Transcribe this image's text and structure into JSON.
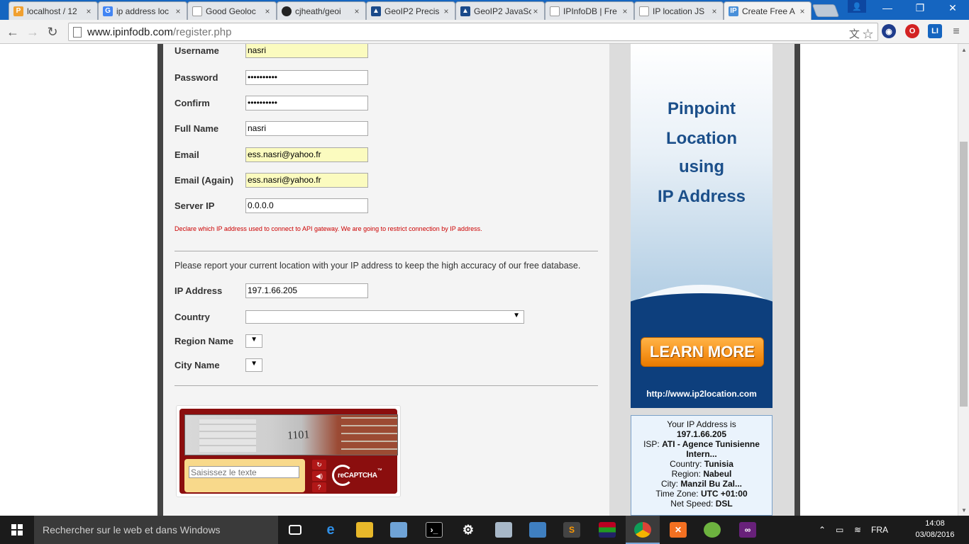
{
  "browser": {
    "tabs": [
      {
        "title": "localhost / 12",
        "favicon": "phpmyadmin-icon",
        "color": "#f0a030"
      },
      {
        "title": "ip address loc",
        "favicon": "google-icon",
        "color": "#4285f4"
      },
      {
        "title": "Good Geoloc",
        "favicon": "page-icon",
        "color": "#b0b0b0"
      },
      {
        "title": "cjheath/geoi",
        "favicon": "github-icon",
        "color": "#222222"
      },
      {
        "title": "GeoIP2 Precis",
        "favicon": "maxmind-icon",
        "color": "#1a4a8a"
      },
      {
        "title": "GeoIP2 JavaSc",
        "favicon": "maxmind-icon",
        "color": "#1a4a8a"
      },
      {
        "title": "IPInfoDB | Fre",
        "favicon": "page-icon",
        "color": "#b0b0b0"
      },
      {
        "title": "IP location JS",
        "favicon": "page-icon",
        "color": "#b0b0b0"
      },
      {
        "title": "Create Free A",
        "favicon": "ipinfodb-icon",
        "color": "#4a90d9"
      }
    ],
    "url_host": "www.ipinfodb.com",
    "url_path": "/register.php"
  },
  "form": {
    "fields": [
      {
        "label": "Username",
        "value": "nasri"
      },
      {
        "label": "Password",
        "value": "••••••••••"
      },
      {
        "label": "Confirm",
        "value": "••••••••••"
      },
      {
        "label": "Full Name",
        "value": "nasri"
      },
      {
        "label": "Email",
        "value": "ess.nasri@yahoo.fr"
      },
      {
        "label": "Email (Again)",
        "value": "ess.nasri@yahoo.fr"
      },
      {
        "label": "Server IP",
        "value": "0.0.0.0"
      }
    ],
    "server_ip_hint": "Declare which IP address used to connect to API gateway. We are going to restrict connection by IP address.",
    "report_text": "Please report your current location with your IP address to keep the high accuracy of our free database.",
    "ip_label": "IP Address",
    "ip_value": "197.1.66.205",
    "country_label": "Country",
    "country_value": "",
    "region_label": "Region Name",
    "city_label": "City Name"
  },
  "captcha": {
    "image_text": "1101",
    "placeholder": "Saisissez le texte",
    "brand": "reCAPTCHA",
    "tm": "™"
  },
  "ad": {
    "line1": "Pinpoint",
    "line2": "Location",
    "line3": "using",
    "line4": "IP Address",
    "button": "LEARN MORE",
    "url": "http://www.ip2location.com"
  },
  "ipinfo": {
    "heading": "Your IP Address is",
    "ip": "197.1.66.205",
    "isp_label": "ISP:",
    "isp_value": "ATI - Agence Tunisienne",
    "isp_value2": "Intern...",
    "country_label": "Country:",
    "country_value": "Tunisia",
    "region_label": "Region:",
    "region_value": "Nabeul",
    "city_label": "City:",
    "city_value": "Manzil Bu Zal...",
    "tz_label": "Time Zone:",
    "tz_value": "UTC +01:00",
    "speed_label": "Net Speed:",
    "speed_value": "DSL"
  },
  "taskbar": {
    "search_placeholder": "Rechercher sur le web et dans Windows",
    "lang": "FRA",
    "time": "14:08",
    "date": "03/08/2016"
  }
}
